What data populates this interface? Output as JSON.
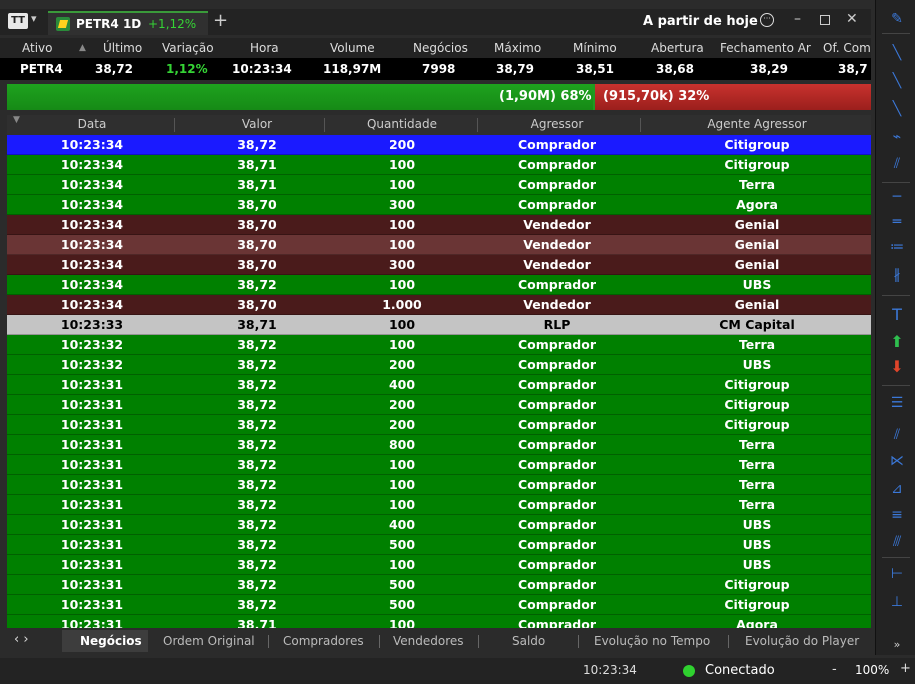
{
  "tabbar": {
    "menu_label": "TT",
    "asset_tab": {
      "name": "PETR4 1D",
      "change": "+1,12%"
    },
    "period": "A partir de hoje"
  },
  "quote": {
    "headers": [
      "Ativo",
      "Último",
      "Variação",
      "Hora",
      "Volume",
      "Negócios",
      "Máximo",
      "Mínimo",
      "Abertura",
      "Fechamento Ar",
      "Of. Com"
    ],
    "values": [
      "PETR4",
      "38,72",
      "1,12%",
      "10:23:34",
      "118,97M",
      "7998",
      "38,79",
      "38,51",
      "38,68",
      "38,29",
      "38,7"
    ]
  },
  "aggression": {
    "buy_label": "(1,90M) 68%",
    "sell_label": "(915,70k) 32%",
    "buy_percent": 68,
    "sell_percent": 32,
    "colors": {
      "buy": "#1a9a1a",
      "sell": "#b02a26"
    }
  },
  "table": {
    "headers": [
      "Data",
      "Valor",
      "Quantidade",
      "Agressor",
      "Agente Agressor"
    ],
    "rows": [
      {
        "time": "10:23:34",
        "price": "38,72",
        "qty": "200",
        "side": "Comprador",
        "agent": "Citigroup",
        "style": "sel"
      },
      {
        "time": "10:23:34",
        "price": "38,71",
        "qty": "100",
        "side": "Comprador",
        "agent": "Citigroup",
        "style": "buy"
      },
      {
        "time": "10:23:34",
        "price": "38,71",
        "qty": "100",
        "side": "Comprador",
        "agent": "Terra",
        "style": "buy"
      },
      {
        "time": "10:23:34",
        "price": "38,70",
        "qty": "300",
        "side": "Comprador",
        "agent": "Agora",
        "style": "buy"
      },
      {
        "time": "10:23:34",
        "price": "38,70",
        "qty": "100",
        "side": "Vendedor",
        "agent": "Genial",
        "style": "sell"
      },
      {
        "time": "10:23:34",
        "price": "38,70",
        "qty": "100",
        "side": "Vendedor",
        "agent": "Genial",
        "style": "sell2"
      },
      {
        "time": "10:23:34",
        "price": "38,70",
        "qty": "300",
        "side": "Vendedor",
        "agent": "Genial",
        "style": "sell"
      },
      {
        "time": "10:23:34",
        "price": "38,72",
        "qty": "100",
        "side": "Comprador",
        "agent": "UBS",
        "style": "buy"
      },
      {
        "time": "10:23:34",
        "price": "38,70",
        "qty": "1.000",
        "side": "Vendedor",
        "agent": "Genial",
        "style": "sell"
      },
      {
        "time": "10:23:33",
        "price": "38,71",
        "qty": "100",
        "side": "RLP",
        "agent": "CM Capital",
        "style": "rlp"
      },
      {
        "time": "10:23:32",
        "price": "38,72",
        "qty": "100",
        "side": "Comprador",
        "agent": "Terra",
        "style": "buy"
      },
      {
        "time": "10:23:32",
        "price": "38,72",
        "qty": "200",
        "side": "Comprador",
        "agent": "UBS",
        "style": "buy"
      },
      {
        "time": "10:23:31",
        "price": "38,72",
        "qty": "400",
        "side": "Comprador",
        "agent": "Citigroup",
        "style": "buy"
      },
      {
        "time": "10:23:31",
        "price": "38,72",
        "qty": "200",
        "side": "Comprador",
        "agent": "Citigroup",
        "style": "buy"
      },
      {
        "time": "10:23:31",
        "price": "38,72",
        "qty": "200",
        "side": "Comprador",
        "agent": "Citigroup",
        "style": "buy"
      },
      {
        "time": "10:23:31",
        "price": "38,72",
        "qty": "800",
        "side": "Comprador",
        "agent": "Terra",
        "style": "buy"
      },
      {
        "time": "10:23:31",
        "price": "38,72",
        "qty": "100",
        "side": "Comprador",
        "agent": "Terra",
        "style": "buy"
      },
      {
        "time": "10:23:31",
        "price": "38,72",
        "qty": "100",
        "side": "Comprador",
        "agent": "Terra",
        "style": "buy"
      },
      {
        "time": "10:23:31",
        "price": "38,72",
        "qty": "100",
        "side": "Comprador",
        "agent": "Terra",
        "style": "buy"
      },
      {
        "time": "10:23:31",
        "price": "38,72",
        "qty": "400",
        "side": "Comprador",
        "agent": "UBS",
        "style": "buy"
      },
      {
        "time": "10:23:31",
        "price": "38,72",
        "qty": "500",
        "side": "Comprador",
        "agent": "UBS",
        "style": "buy"
      },
      {
        "time": "10:23:31",
        "price": "38,72",
        "qty": "100",
        "side": "Comprador",
        "agent": "UBS",
        "style": "buy"
      },
      {
        "time": "10:23:31",
        "price": "38,72",
        "qty": "500",
        "side": "Comprador",
        "agent": "Citigroup",
        "style": "buy"
      },
      {
        "time": "10:23:31",
        "price": "38,72",
        "qty": "500",
        "side": "Comprador",
        "agent": "Citigroup",
        "style": "buy"
      },
      {
        "time": "10:23:31",
        "price": "38,71",
        "qty": "100",
        "side": "Comprador",
        "agent": "Agora",
        "style": "buy"
      }
    ]
  },
  "bottom_tabs": [
    "Negócios",
    "Ordem Original",
    "Compradores",
    "Vendedores",
    "Saldo",
    "Evolução no Tempo",
    "Evolução do Player"
  ],
  "status": {
    "time": "10:23:34",
    "connection": "Conectado",
    "zoom": "100%"
  },
  "toolbar_icons": [
    "brush-icon",
    "line-icon",
    "diagonal-line-icon",
    "ray-icon",
    "zigzag-icon",
    "channel-icon",
    "horizontal-line-icon",
    "parallel-lines-icon",
    "dotted-lines-icon",
    "fibonacci-icon",
    "text-icon",
    "arrow-up-icon",
    "arrow-down-icon",
    "multiline-icon",
    "channel-c-icon",
    "fan-icon",
    "fibonacci-fan-icon",
    "fibonacci-p-icon",
    "fibonacci-f-icon",
    "measure-icon",
    "baseline-icon",
    "more-icon"
  ]
}
